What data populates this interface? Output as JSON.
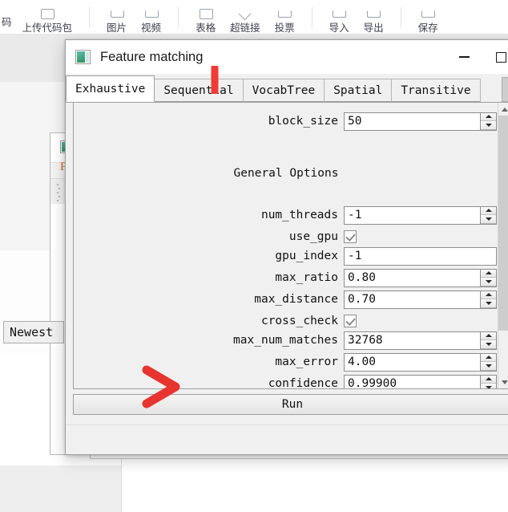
{
  "background": {
    "toolbar": {
      "partial_left_label": "码",
      "groups": [
        {
          "items": [
            {
              "label": "上传代码包",
              "icon": "upload-package-icon"
            }
          ]
        },
        {
          "items": [
            {
              "label": "图片",
              "icon": "image-icon"
            },
            {
              "label": "视频",
              "icon": "video-icon"
            }
          ]
        },
        {
          "items": [
            {
              "label": "表格",
              "icon": "table-icon"
            },
            {
              "label": "超链接",
              "icon": "link-icon"
            },
            {
              "label": "投票",
              "icon": "poll-icon"
            }
          ]
        },
        {
          "items": [
            {
              "label": "导入",
              "icon": "import-icon"
            },
            {
              "label": "导出",
              "icon": "export-icon"
            }
          ]
        },
        {
          "items": [
            {
              "label": "保存",
              "icon": "save-icon"
            }
          ]
        }
      ]
    },
    "hidden_window": {
      "title_fragment": "Fi",
      "icon": "app-icon"
    },
    "newest_button": "Newest"
  },
  "dialog": {
    "title": "Feature matching",
    "icon": "app-icon",
    "controls": {
      "minimize": "minimize-icon",
      "maximize": "maximize-icon"
    },
    "tabs": [
      {
        "label": "Exhaustive",
        "selected": true
      },
      {
        "label": "Sequential",
        "selected": false
      },
      {
        "label": "VocabTree",
        "selected": false
      },
      {
        "label": "Spatial",
        "selected": false
      },
      {
        "label": "Transitive",
        "selected": false
      }
    ],
    "tab_scroll_icon": "chevron-left-icon",
    "section_title": "General Options",
    "fields": [
      {
        "name": "block_size",
        "label": "block_size",
        "value": "50",
        "type": "spinner"
      },
      {
        "name": "num_threads",
        "label": "num_threads",
        "value": "-1",
        "type": "spinner"
      },
      {
        "name": "use_gpu",
        "label": "use_gpu",
        "value": true,
        "type": "checkbox"
      },
      {
        "name": "gpu_index",
        "label": "gpu_index",
        "value": "-1",
        "type": "text"
      },
      {
        "name": "max_ratio",
        "label": "max_ratio",
        "value": "0.80",
        "type": "spinner"
      },
      {
        "name": "max_distance",
        "label": "max_distance",
        "value": "0.70",
        "type": "spinner"
      },
      {
        "name": "cross_check",
        "label": "cross_check",
        "value": true,
        "type": "checkbox"
      },
      {
        "name": "max_num_matches",
        "label": "max_num_matches",
        "value": "32768",
        "type": "spinner"
      },
      {
        "name": "max_error",
        "label": "max_error",
        "value": "4.00",
        "type": "spinner"
      },
      {
        "name": "confidence",
        "label": "confidence",
        "value": "0.99900",
        "type": "spinner"
      }
    ],
    "run_button": "Run"
  },
  "annotations": {
    "color": "#ef3b36",
    "marks": [
      {
        "name": "vertical-stroke-on-sequential-tab",
        "shape": "vertical-line"
      },
      {
        "name": "zigzag-arrow-near-confidence",
        "shape": "zigzag"
      }
    ]
  }
}
